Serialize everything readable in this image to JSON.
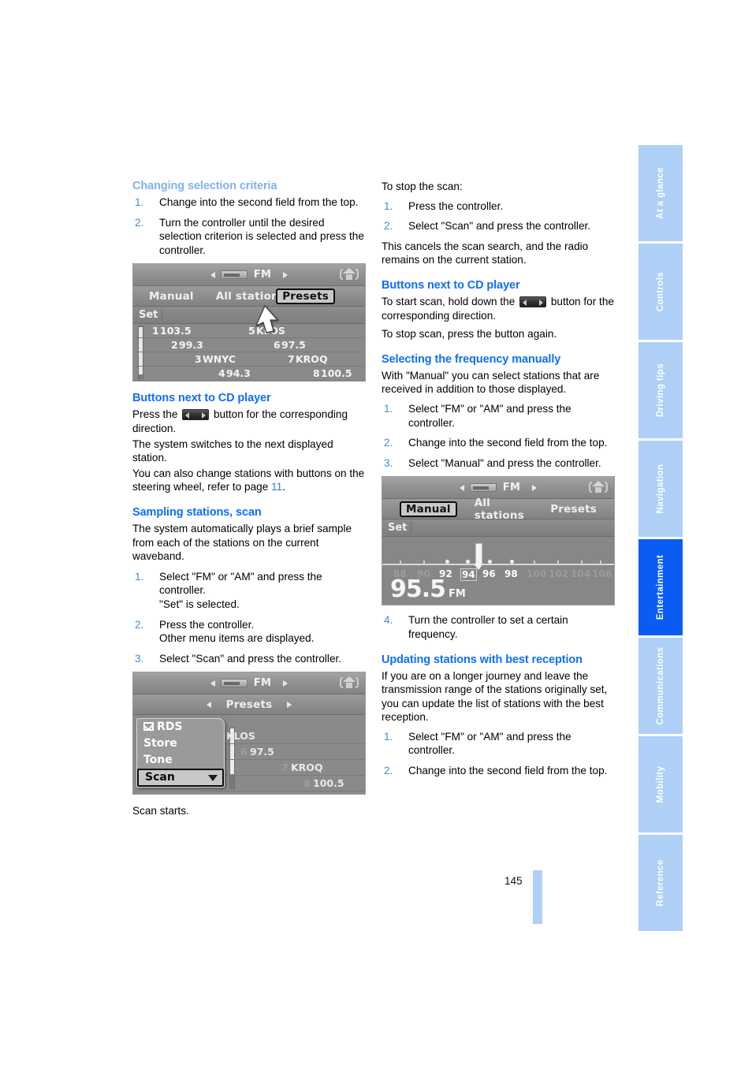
{
  "page": {
    "number": "145"
  },
  "sidebar": {
    "items": [
      {
        "label": "At a glance",
        "active": false
      },
      {
        "label": "Controls",
        "active": false
      },
      {
        "label": "Driving tips",
        "active": false
      },
      {
        "label": "Navigation",
        "active": false
      },
      {
        "label": "Entertainment",
        "active": true
      },
      {
        "label": "Communications",
        "active": false
      },
      {
        "label": "Mobility",
        "active": false
      },
      {
        "label": "Reference",
        "active": false
      }
    ],
    "active_color": "#0a5cf5",
    "inactive_color": "#aed0f7"
  },
  "left_column": {
    "section1": {
      "heading": "Changing selection criteria",
      "steps": [
        {
          "num": "1.",
          "text": "Change into the second field from the top."
        },
        {
          "num": "2.",
          "text": "Turn the controller until the desired selection criterion is selected and press the controller."
        }
      ]
    },
    "figure1": {
      "band": "FM",
      "tabs": [
        {
          "label": "Manual",
          "selected": false
        },
        {
          "label": "All stations",
          "selected": false
        },
        {
          "label": "Presets",
          "selected": true
        }
      ],
      "set_label": "Set",
      "presets": [
        {
          "left_num": "1",
          "left_name": "103.5",
          "right_num": "5",
          "right_name": "KLOS"
        },
        {
          "left_num": "2",
          "left_name": "99.3",
          "right_num": "6",
          "right_name": "97.5"
        },
        {
          "left_num": "3",
          "left_name": "WNYC",
          "right_num": "7",
          "right_name": "KROQ"
        },
        {
          "left_num": "4",
          "left_name": "94.3",
          "right_num": "8",
          "right_name": "100.5"
        }
      ]
    },
    "section2": {
      "heading": "Buttons next to CD player",
      "line1_before": "Press the",
      "line1_after": "button for the corresponding direction.",
      "line2": "The system switches to the next displayed station.",
      "line3_before": "You can also change stations with buttons on the steering wheel, refer to page",
      "line3_link": "11",
      "line3_after": "."
    },
    "section3": {
      "heading": "Sampling stations, scan",
      "intro": "The system automatically plays a brief sample from each of the stations on the current waveband.",
      "steps": [
        {
          "num": "1.",
          "text": "Select \"FM\" or \"AM\" and press the controller.",
          "sub": "\"Set\" is selected."
        },
        {
          "num": "2.",
          "text": "Press the controller.",
          "sub": "Other menu items are displayed."
        },
        {
          "num": "3.",
          "text": "Select \"Scan\" and press the controller.",
          "sub": ""
        }
      ]
    },
    "figure2": {
      "band": "FM",
      "presets_tab": "Presets",
      "menu_items": [
        {
          "label": "RDS",
          "checked": true,
          "selected": false
        },
        {
          "label": "Store",
          "checked": false,
          "selected": false
        },
        {
          "label": "Tone",
          "checked": false,
          "selected": false
        },
        {
          "label": "Scan",
          "checked": false,
          "selected": true
        }
      ],
      "background_presets": [
        {
          "num": "5",
          "name": "KLOS"
        },
        {
          "num": "6",
          "name": "97.5"
        },
        {
          "num": "7",
          "name": "KROQ"
        },
        {
          "num": "8",
          "name": "100.5"
        }
      ]
    },
    "caption": "Scan starts."
  },
  "right_column": {
    "stop_scan": {
      "intro": "To stop the scan:",
      "steps": [
        {
          "num": "1.",
          "text": "Press the controller."
        },
        {
          "num": "2.",
          "text": "Select \"Scan\" and press the controller."
        }
      ],
      "outro": "This cancels the scan search, and the radio remains on the current station."
    },
    "section_buttons": {
      "heading": "Buttons next to CD player",
      "line1_before": "To start scan, hold down the",
      "line1_after": "button for the corresponding direction.",
      "line2": "To stop scan, press the button again."
    },
    "section_manual": {
      "heading": "Selecting the frequency manually",
      "intro": "With \"Manual\" you can select stations that are received in addition to those displayed.",
      "steps": [
        {
          "num": "1.",
          "text": "Select \"FM\" or \"AM\" and press the controller."
        },
        {
          "num": "2.",
          "text": "Change into the second field from the top."
        },
        {
          "num": "3.",
          "text": "Select \"Manual\" and press the controller."
        }
      ],
      "step4": {
        "num": "4.",
        "text": "Turn the controller to set a certain frequency."
      }
    },
    "figure3": {
      "band": "FM",
      "tabs": [
        {
          "label": "Manual",
          "selected": true
        },
        {
          "label": "All stations",
          "selected": false
        },
        {
          "label": "Presets",
          "selected": false
        }
      ],
      "set_label": "Set",
      "scale_ticks": [
        "88",
        "90",
        "92",
        "94",
        "96",
        "98",
        "100",
        "102",
        "104",
        "106"
      ],
      "current_frequency": "95.5",
      "current_band": "FM"
    },
    "section_update": {
      "heading": "Updating stations with best reception",
      "intro": "If you are on a longer journey and leave the transmission range of the stations originally set, you can update the list of stations with the best reception.",
      "steps": [
        {
          "num": "1.",
          "text": "Select \"FM\" or \"AM\" and press the controller."
        },
        {
          "num": "2.",
          "text": "Change into the second field from the top."
        }
      ]
    }
  }
}
